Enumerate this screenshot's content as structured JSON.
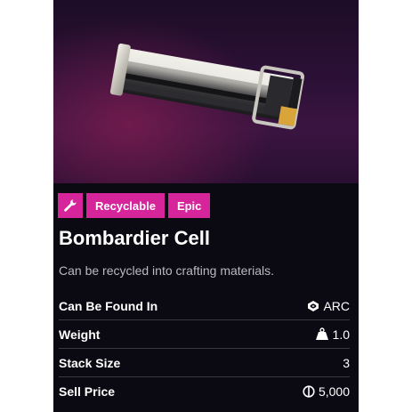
{
  "item": {
    "name": "Bombardier Cell",
    "description": "Can be recycled into crafting materials.",
    "badges": {
      "icon": "wrench-icon",
      "type_label": "Recyclable",
      "rarity_label": "Epic",
      "color": "#d6259b"
    },
    "stats": {
      "found_in": {
        "label": "Can Be Found In",
        "icon": "arc-icon",
        "value": "ARC"
      },
      "weight": {
        "label": "Weight",
        "icon": "weight-icon",
        "value": "1.0"
      },
      "stack_size": {
        "label": "Stack Size",
        "value": "3"
      },
      "sell_price": {
        "label": "Sell Price",
        "icon": "coin-icon",
        "value": "5,000"
      }
    }
  }
}
